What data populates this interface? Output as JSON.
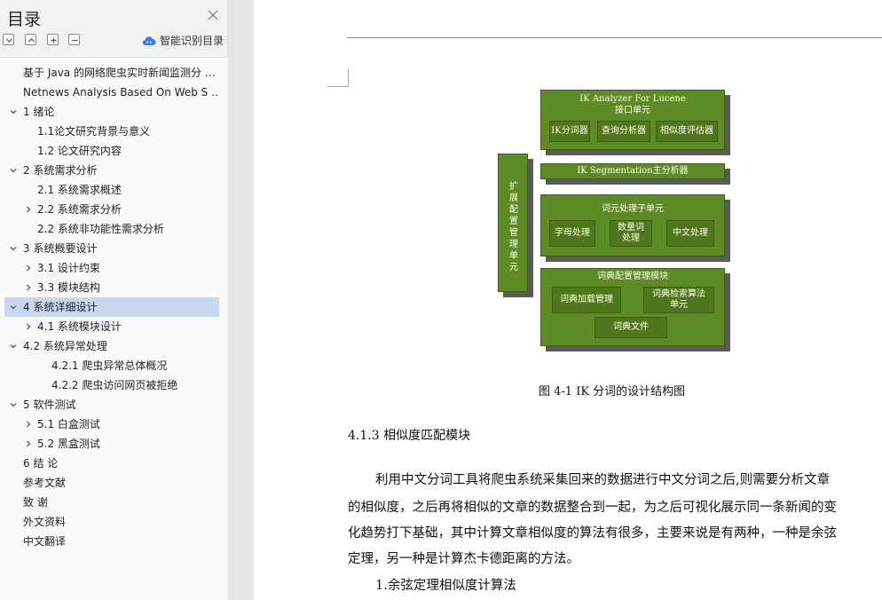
{
  "sidebar": {
    "title": "目录",
    "smart_toc_label": "智能识别目录",
    "toolbar": [
      "collapse-all",
      "expand-up",
      "add",
      "remove"
    ],
    "items": [
      {
        "label": "基于 Java 的网络爬虫实时新闻监测分 …",
        "chevron": "none"
      },
      {
        "label": "Netnews Analysis Based On Web S …",
        "chevron": "none"
      },
      {
        "label": "1   绪论",
        "chevron": "down"
      },
      {
        "label": "1.1论文研究背景与意义",
        "chevron": "none"
      },
      {
        "label": "1.2  论文研究内容",
        "chevron": "none"
      },
      {
        "label": "2   系统需求分析",
        "chevron": "down"
      },
      {
        "label": "2.1  系统需求概述",
        "chevron": "none"
      },
      {
        "label": "2.2  系统需求分析",
        "chevron": "right"
      },
      {
        "label": "2.2  系统非功能性需求分析",
        "chevron": "none"
      },
      {
        "label": "3   系统概要设计",
        "chevron": "down"
      },
      {
        "label": "3.1  设计约束",
        "chevron": "right"
      },
      {
        "label": "3.3  模块结构",
        "chevron": "right"
      },
      {
        "label": "4  系统详细设计",
        "chevron": "down",
        "selected": true
      },
      {
        "label": "4.1  系统模块设计",
        "chevron": "right"
      },
      {
        "label": "4.2  系统异常处理",
        "chevron": "down"
      },
      {
        "label": "4.2.1  爬虫异常总体概况",
        "chevron": "none"
      },
      {
        "label": "4.2.2  爬虫访问网页被拒绝",
        "chevron": "none"
      },
      {
        "label": "5  软件测试",
        "chevron": "down"
      },
      {
        "label": "5.1  白盒测试",
        "chevron": "right"
      },
      {
        "label": "5.2  黑盒测试",
        "chevron": "right"
      },
      {
        "label": "6   结   论",
        "chevron": "none"
      },
      {
        "label": "参考文献",
        "chevron": "none"
      },
      {
        "label": "致   谢",
        "chevron": "none"
      },
      {
        "label": "外文资料",
        "chevron": "none"
      },
      {
        "label": "中文翻译",
        "chevron": "none"
      }
    ]
  },
  "document": {
    "diagram": {
      "interface_unit_title": "IK Analyzer For Lucene",
      "interface_unit_subtitle": "接口单元",
      "interface_items": [
        "IK分词器",
        "查询分析器",
        "相似度评估器"
      ],
      "main_analyzer": "IK Segmentation主分析器",
      "token_unit_title": "词元处理子单元",
      "token_items": [
        "字母处理",
        "数量词处理",
        "中文处理"
      ],
      "dict_module_title": "词典配置管理模块",
      "dict_items": [
        "词典加载管理",
        "词典检索算法单元",
        "词典文件"
      ],
      "side_unit": "扩展配置管理单元"
    },
    "figure_caption": "图 4-1 IK 分词的设计结构图",
    "section_heading": "4.1.3  相似度匹配模块",
    "paragraph_lines": [
      "利用中文分词工具将爬虫系统采集回来的数据进行中文分词之后,则需要分析文章",
      "的相似度，之后再将相似的文章的数据整合到一起，为之后可视化展示同一条新闻的变",
      "化趋势打下基础，其中计算文章相似度的算法有很多，主要来说是有两种，一种是余弦",
      "定理，另一种是计算杰卡德距离的方法。"
    ],
    "list_item": "1.余弦定理相似度计算法"
  },
  "colors": {
    "selected_bg": "#c9d7ef",
    "diagram_green": "#5d8b26",
    "diagram_inner": "#4f771b"
  }
}
